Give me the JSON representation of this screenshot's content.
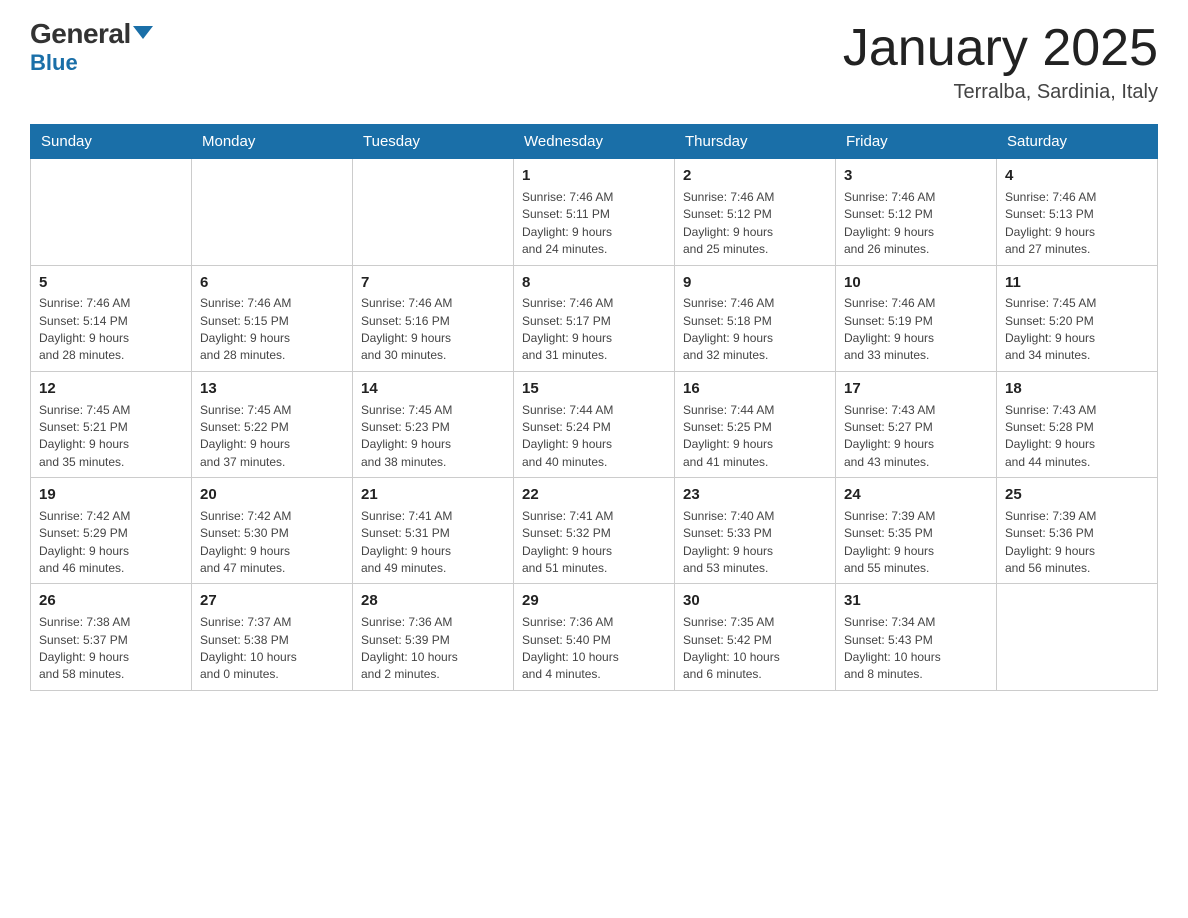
{
  "header": {
    "logo_general": "General",
    "logo_blue": "Blue",
    "title": "January 2025",
    "location": "Terralba, Sardinia, Italy"
  },
  "weekdays": [
    "Sunday",
    "Monday",
    "Tuesday",
    "Wednesday",
    "Thursday",
    "Friday",
    "Saturday"
  ],
  "weeks": [
    [
      {
        "day": "",
        "info": ""
      },
      {
        "day": "",
        "info": ""
      },
      {
        "day": "",
        "info": ""
      },
      {
        "day": "1",
        "info": "Sunrise: 7:46 AM\nSunset: 5:11 PM\nDaylight: 9 hours\nand 24 minutes."
      },
      {
        "day": "2",
        "info": "Sunrise: 7:46 AM\nSunset: 5:12 PM\nDaylight: 9 hours\nand 25 minutes."
      },
      {
        "day": "3",
        "info": "Sunrise: 7:46 AM\nSunset: 5:12 PM\nDaylight: 9 hours\nand 26 minutes."
      },
      {
        "day": "4",
        "info": "Sunrise: 7:46 AM\nSunset: 5:13 PM\nDaylight: 9 hours\nand 27 minutes."
      }
    ],
    [
      {
        "day": "5",
        "info": "Sunrise: 7:46 AM\nSunset: 5:14 PM\nDaylight: 9 hours\nand 28 minutes."
      },
      {
        "day": "6",
        "info": "Sunrise: 7:46 AM\nSunset: 5:15 PM\nDaylight: 9 hours\nand 28 minutes."
      },
      {
        "day": "7",
        "info": "Sunrise: 7:46 AM\nSunset: 5:16 PM\nDaylight: 9 hours\nand 30 minutes."
      },
      {
        "day": "8",
        "info": "Sunrise: 7:46 AM\nSunset: 5:17 PM\nDaylight: 9 hours\nand 31 minutes."
      },
      {
        "day": "9",
        "info": "Sunrise: 7:46 AM\nSunset: 5:18 PM\nDaylight: 9 hours\nand 32 minutes."
      },
      {
        "day": "10",
        "info": "Sunrise: 7:46 AM\nSunset: 5:19 PM\nDaylight: 9 hours\nand 33 minutes."
      },
      {
        "day": "11",
        "info": "Sunrise: 7:45 AM\nSunset: 5:20 PM\nDaylight: 9 hours\nand 34 minutes."
      }
    ],
    [
      {
        "day": "12",
        "info": "Sunrise: 7:45 AM\nSunset: 5:21 PM\nDaylight: 9 hours\nand 35 minutes."
      },
      {
        "day": "13",
        "info": "Sunrise: 7:45 AM\nSunset: 5:22 PM\nDaylight: 9 hours\nand 37 minutes."
      },
      {
        "day": "14",
        "info": "Sunrise: 7:45 AM\nSunset: 5:23 PM\nDaylight: 9 hours\nand 38 minutes."
      },
      {
        "day": "15",
        "info": "Sunrise: 7:44 AM\nSunset: 5:24 PM\nDaylight: 9 hours\nand 40 minutes."
      },
      {
        "day": "16",
        "info": "Sunrise: 7:44 AM\nSunset: 5:25 PM\nDaylight: 9 hours\nand 41 minutes."
      },
      {
        "day": "17",
        "info": "Sunrise: 7:43 AM\nSunset: 5:27 PM\nDaylight: 9 hours\nand 43 minutes."
      },
      {
        "day": "18",
        "info": "Sunrise: 7:43 AM\nSunset: 5:28 PM\nDaylight: 9 hours\nand 44 minutes."
      }
    ],
    [
      {
        "day": "19",
        "info": "Sunrise: 7:42 AM\nSunset: 5:29 PM\nDaylight: 9 hours\nand 46 minutes."
      },
      {
        "day": "20",
        "info": "Sunrise: 7:42 AM\nSunset: 5:30 PM\nDaylight: 9 hours\nand 47 minutes."
      },
      {
        "day": "21",
        "info": "Sunrise: 7:41 AM\nSunset: 5:31 PM\nDaylight: 9 hours\nand 49 minutes."
      },
      {
        "day": "22",
        "info": "Sunrise: 7:41 AM\nSunset: 5:32 PM\nDaylight: 9 hours\nand 51 minutes."
      },
      {
        "day": "23",
        "info": "Sunrise: 7:40 AM\nSunset: 5:33 PM\nDaylight: 9 hours\nand 53 minutes."
      },
      {
        "day": "24",
        "info": "Sunrise: 7:39 AM\nSunset: 5:35 PM\nDaylight: 9 hours\nand 55 minutes."
      },
      {
        "day": "25",
        "info": "Sunrise: 7:39 AM\nSunset: 5:36 PM\nDaylight: 9 hours\nand 56 minutes."
      }
    ],
    [
      {
        "day": "26",
        "info": "Sunrise: 7:38 AM\nSunset: 5:37 PM\nDaylight: 9 hours\nand 58 minutes."
      },
      {
        "day": "27",
        "info": "Sunrise: 7:37 AM\nSunset: 5:38 PM\nDaylight: 10 hours\nand 0 minutes."
      },
      {
        "day": "28",
        "info": "Sunrise: 7:36 AM\nSunset: 5:39 PM\nDaylight: 10 hours\nand 2 minutes."
      },
      {
        "day": "29",
        "info": "Sunrise: 7:36 AM\nSunset: 5:40 PM\nDaylight: 10 hours\nand 4 minutes."
      },
      {
        "day": "30",
        "info": "Sunrise: 7:35 AM\nSunset: 5:42 PM\nDaylight: 10 hours\nand 6 minutes."
      },
      {
        "day": "31",
        "info": "Sunrise: 7:34 AM\nSunset: 5:43 PM\nDaylight: 10 hours\nand 8 minutes."
      },
      {
        "day": "",
        "info": ""
      }
    ]
  ]
}
